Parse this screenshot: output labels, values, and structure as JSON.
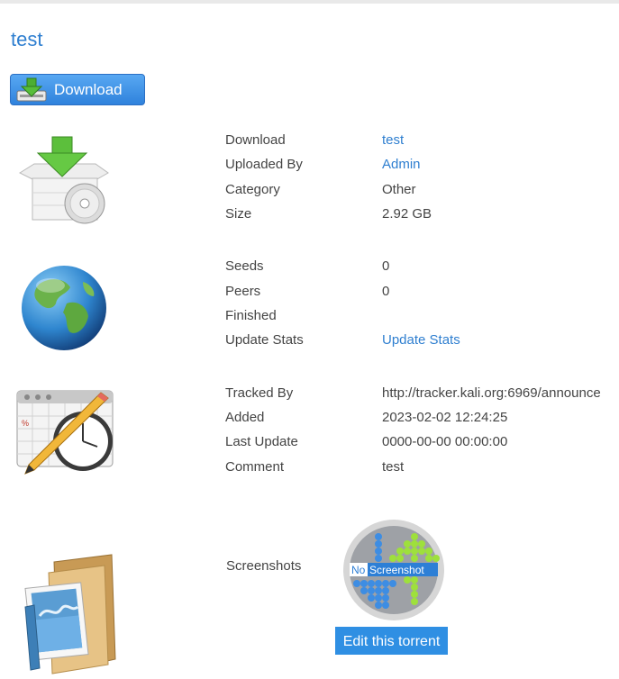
{
  "title": "test",
  "download_button": {
    "label": "Download",
    "icon": "download-arrow-icon"
  },
  "details": {
    "download": {
      "label": "Download",
      "value": "test"
    },
    "uploaded_by": {
      "label": "Uploaded By",
      "value": "Admin"
    },
    "category": {
      "label": "Category",
      "value": "Other"
    },
    "size": {
      "label": "Size",
      "value": "2.92 GB"
    }
  },
  "stats": {
    "seeds": {
      "label": "Seeds",
      "value": "0"
    },
    "peers": {
      "label": "Peers",
      "value": "0"
    },
    "finished": {
      "label": "Finished",
      "value": ""
    },
    "update_stats": {
      "label": "Update Stats",
      "value": "Update Stats"
    }
  },
  "tracker": {
    "tracked_by": {
      "label": "Tracked By",
      "value": "http://tracker.kali.org:6969/announce"
    },
    "added": {
      "label": "Added",
      "value": "2023-02-02 12:24:25"
    },
    "last_update": {
      "label": "Last Update",
      "value": "0000-00-00 00:00:00"
    },
    "comment": {
      "label": "Comment",
      "value": "test"
    }
  },
  "screenshots": {
    "label": "Screenshots",
    "placeholder_text_no": "No",
    "placeholder_text_rest": "Screenshot",
    "edit_button": "Edit this torrent"
  },
  "colors": {
    "link": "#2f7fd0",
    "button": "#2f8fe3"
  }
}
